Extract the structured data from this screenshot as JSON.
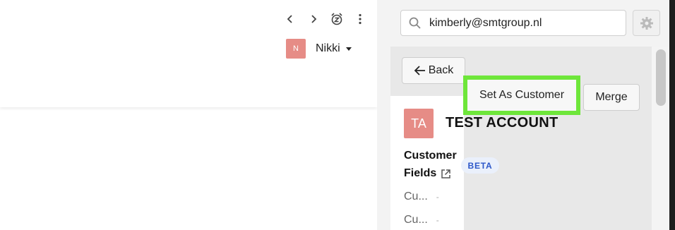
{
  "user": {
    "initial": "N",
    "name": "Nikki"
  },
  "nav_icons": [
    "chevron-left-icon",
    "chevron-right-icon",
    "snooze-alarm-icon",
    "more-vert-icon"
  ],
  "search": {
    "value": "kimberly@smtgroup.nl"
  },
  "actions": {
    "back_label": "Back",
    "set_customer_label": "Set As Customer",
    "merge_label": "Merge"
  },
  "account": {
    "initials": "TA",
    "name": "TEST ACCOUNT"
  },
  "customer_fields": {
    "title_line1": "Customer",
    "title_line2": "Fields",
    "badge": "BETA",
    "rows": [
      {
        "label": "Cu...",
        "value": "-"
      },
      {
        "label": "Cu...",
        "value": "-"
      }
    ]
  },
  "colors": {
    "avatar": "#e68c86",
    "highlight": "#6ee63a",
    "badge_text": "#2c57c9",
    "badge_bg": "#eaf0fb"
  }
}
